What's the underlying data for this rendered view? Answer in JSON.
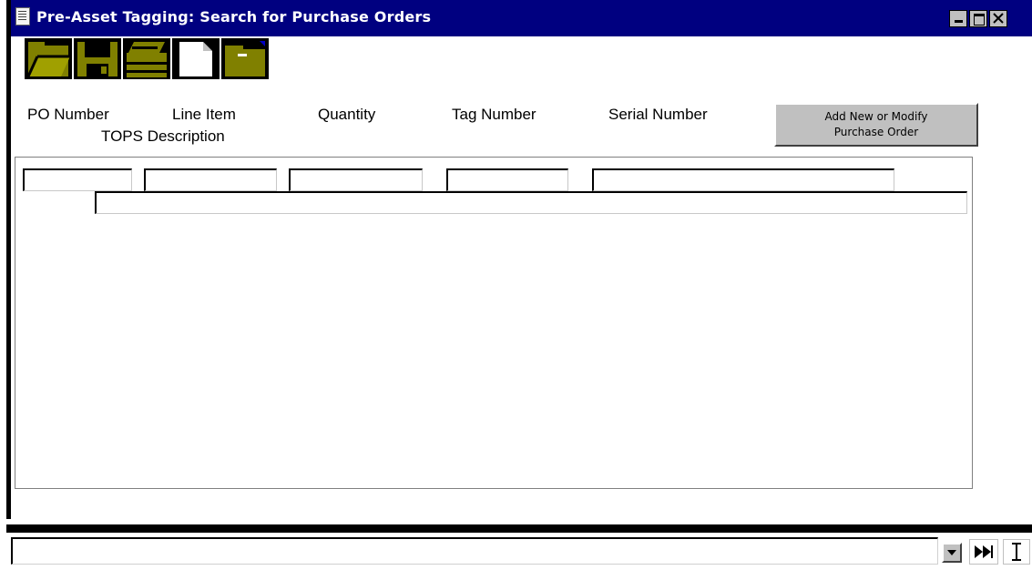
{
  "window": {
    "title": "Pre-Asset Tagging: Search for Purchase Orders",
    "controls": [
      "minimize",
      "maximize",
      "close"
    ]
  },
  "toolbar": {
    "buttons": [
      {
        "name": "open-folder-icon"
      },
      {
        "name": "save-disk-icon"
      },
      {
        "name": "print-icon"
      },
      {
        "name": "new-document-icon"
      },
      {
        "name": "folder-icon"
      }
    ]
  },
  "headers": {
    "po_number": "PO Number",
    "line_item": "Line Item",
    "quantity": "Quantity",
    "tag_number": "Tag Number",
    "serial_number": "Serial Number",
    "tops_description": "TOPS Description"
  },
  "add_button": {
    "line1": "Add New or Modify",
    "line2": "Purchase Order"
  },
  "fields": {
    "po_number": "",
    "line_item": "",
    "quantity": "",
    "tag_number": "",
    "serial_number": "",
    "tops_description": ""
  },
  "status_bar": {
    "value": ""
  },
  "colors": {
    "titlebar": "#000080",
    "toolbar_icon": "#808000",
    "button_face": "#c0c0c0"
  }
}
